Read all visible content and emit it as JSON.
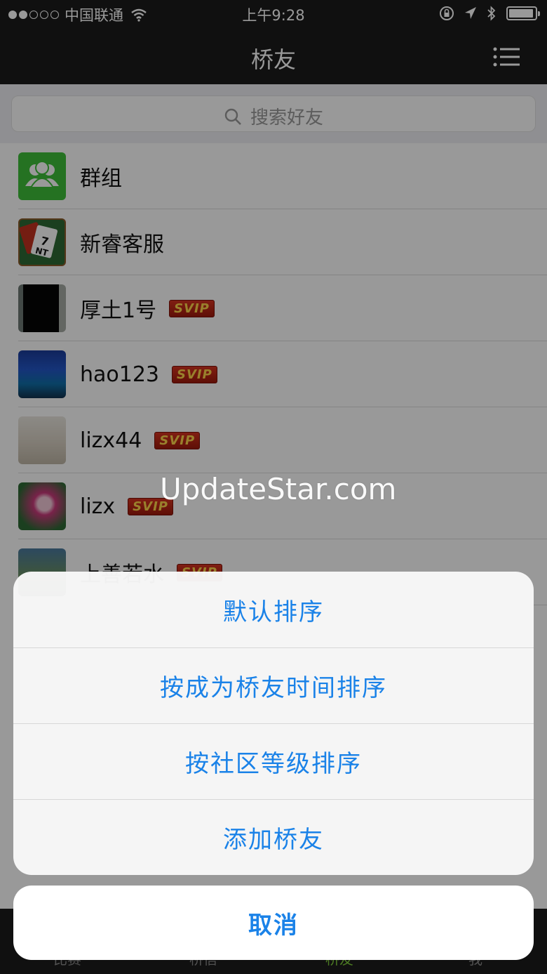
{
  "status_bar": {
    "carrier": "中国联通",
    "time": "上午9:28"
  },
  "nav": {
    "title": "桥友"
  },
  "search": {
    "placeholder": "搜索好友"
  },
  "contacts": [
    {
      "name": "群组",
      "badge": ""
    },
    {
      "name": "新睿客服",
      "badge": ""
    },
    {
      "name": "厚土1号",
      "badge": "SVIP"
    },
    {
      "name": "hao123",
      "badge": "SVIP"
    },
    {
      "name": "lizx44",
      "badge": "SVIP"
    },
    {
      "name": "lizx",
      "badge": "SVIP"
    },
    {
      "name": "上善若水",
      "badge": "SVIP"
    }
  ],
  "tabbar": {
    "tabs": [
      "比赛",
      "桥信",
      "桥友",
      "我"
    ]
  },
  "watermark": "UpdateStar.com",
  "action_sheet": {
    "items": [
      "默认排序",
      "按成为桥友时间排序",
      "按社区等级排序",
      "添加桥友"
    ],
    "cancel": "取消"
  },
  "colors": {
    "accent": "#1a82e8",
    "bar_bg": "#1b1b1b",
    "group_green": "#3fbf3a",
    "badge_red": "#c62a16"
  }
}
